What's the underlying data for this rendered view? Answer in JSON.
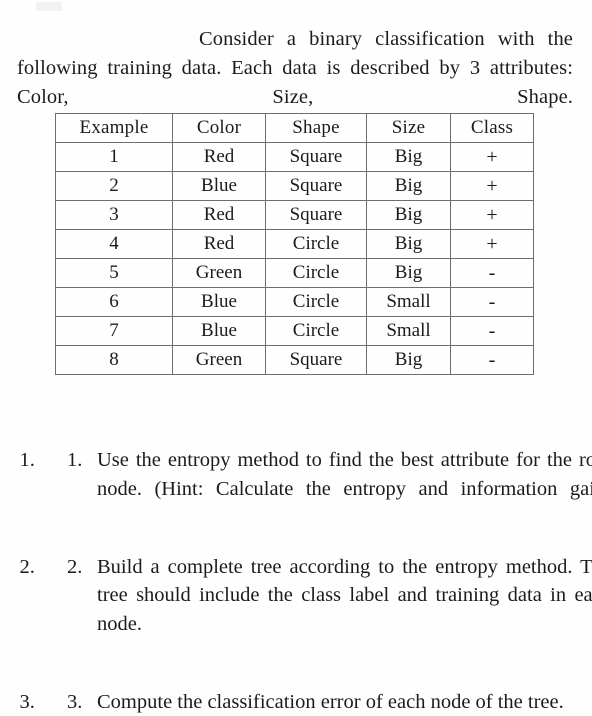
{
  "document": {
    "intro_paragraph": "Consider a binary classification with the following training data. Each data is described by 3 attributes: Color, Size, Shape.",
    "table": {
      "headers": [
        "Example",
        "Color",
        "Shape",
        "Size",
        "Class"
      ],
      "rows": [
        [
          "1",
          "Red",
          "Square",
          "Big",
          "+"
        ],
        [
          "2",
          "Blue",
          "Square",
          "Big",
          "+"
        ],
        [
          "3",
          "Red",
          "Square",
          "Big",
          "+"
        ],
        [
          "4",
          "Red",
          "Circle",
          "Big",
          "+"
        ],
        [
          "5",
          "Green",
          "Circle",
          "Big",
          "-"
        ],
        [
          "6",
          "Blue",
          "Circle",
          "Small",
          "-"
        ],
        [
          "7",
          "Blue",
          "Circle",
          "Small",
          "-"
        ],
        [
          "8",
          "Green",
          "Square",
          "Big",
          "-"
        ]
      ]
    },
    "questions": [
      {
        "number": "1.",
        "text": "Use the entropy method to find the best attribute for the root node. (Hint: Calculate the entropy and information gain)"
      },
      {
        "number": "2.",
        "text": "Build a complete tree according to the entropy method. The tree should include the class label and training data in each node."
      },
      {
        "number": "3.",
        "text": "Compute the classification error of each node of the tree."
      }
    ]
  },
  "colors": {
    "page_background": "#fefefe",
    "text": "#1b1b1b",
    "table_border": "#6e6e6e"
  }
}
